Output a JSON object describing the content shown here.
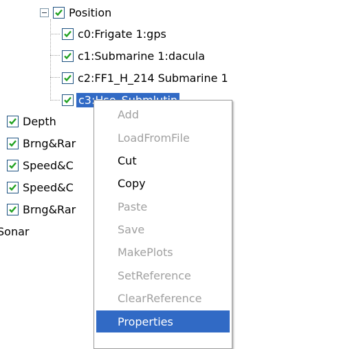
{
  "tree": {
    "position": {
      "label": "Position",
      "checked": true,
      "expanded": true
    },
    "children": [
      {
        "label": "c0:Frigate 1:gps",
        "checked": true
      },
      {
        "label": "c1:Submarine 1:dacula",
        "checked": true
      },
      {
        "label": "c2:FF1_H_214 Submarine 1",
        "checked": true
      },
      {
        "label": "c3:Hse_Submlutin",
        "checked": true,
        "selected": true
      }
    ],
    "siblings": [
      {
        "label": "Depth",
        "checked": true
      },
      {
        "label": "Brng&Rar",
        "checked": true
      },
      {
        "label": "Speed&C",
        "checked": true
      },
      {
        "label": "Speed&C",
        "checked": true
      },
      {
        "label": "Brng&Rar",
        "checked": true
      }
    ],
    "sonar": {
      "label": "Sonar"
    }
  },
  "context_menu": {
    "items": [
      {
        "label": "Add",
        "enabled": false
      },
      {
        "label": "LoadFromFile",
        "enabled": false
      },
      {
        "label": "Cut",
        "enabled": true
      },
      {
        "label": "Copy",
        "enabled": true
      },
      {
        "label": "Paste",
        "enabled": false
      },
      {
        "label": "Save",
        "enabled": false
      },
      {
        "label": "MakePlots",
        "enabled": false
      },
      {
        "label": "SetReference",
        "enabled": false
      },
      {
        "label": "ClearReference",
        "enabled": false
      },
      {
        "label": "Properties",
        "enabled": true,
        "highlighted": true
      }
    ]
  },
  "colors": {
    "selection": "#316ac5",
    "checkmark": "#21a121",
    "checkbox_border": "#1c5180",
    "disabled_text": "#a0a0a0"
  },
  "icons": {
    "expander": "minus-expander-icon",
    "checkbox": "checkbox-checked-icon"
  }
}
